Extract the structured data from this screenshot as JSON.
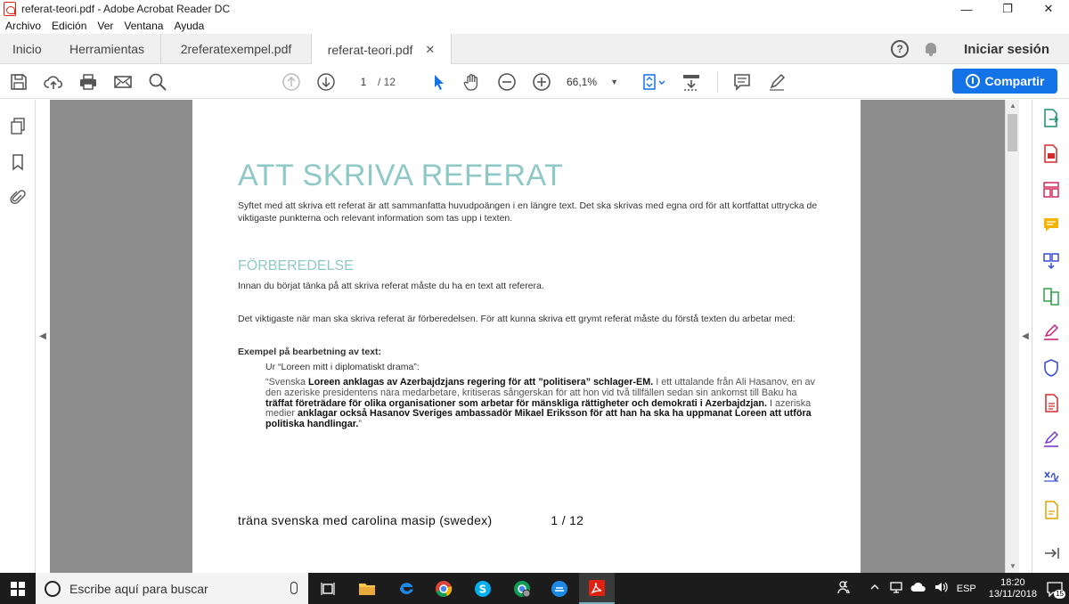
{
  "window": {
    "title": "referat-teori.pdf - Adobe Acrobat Reader DC",
    "minimize": "—",
    "maximize": "❐",
    "close": "✕"
  },
  "menu": [
    "Archivo",
    "Edición",
    "Ver",
    "Ventana",
    "Ayuda"
  ],
  "tabs": {
    "home": "Inicio",
    "tools": "Herramientas",
    "doc1": "2referatexempel.pdf",
    "doc2": "referat-teori.pdf",
    "close": "✕"
  },
  "header": {
    "help": "?",
    "signin": "Iniciar sesión"
  },
  "toolbar": {
    "page_current": "1",
    "page_total": "/ 12",
    "zoom": "66,1%",
    "zoom_caret": "▼",
    "share": "Compartir"
  },
  "document": {
    "title": "ATT SKRIVA REFERAT",
    "intro": "Syftet med att skriva ett referat är att sammanfatta huvudpoängen i en längre text. Det ska skrivas med egna ord för att kortfattat uttrycka de viktigaste punkterna och relevant information som tas upp i texten.",
    "section": "FÖRBEREDELSE",
    "p1": "Innan du börjat tänka på att skriva referat måste du ha en text att referera.",
    "p2": "Det viktigaste när man ska skriva referat är förberedelsen. För att kunna skriva ett grymt referat måste du förstå texten du arbetar med:",
    "example_heading": "Exempel på bearbetning av text:",
    "example_source": "Ur “Loreen mitt i diplomatiskt drama”:",
    "quote": {
      "s1": "“Svenska ",
      "b1": "Loreen anklagas av Azerbajdzjans regering för att ”politisera” schlager-EM.",
      "s2": " I ett uttalande från Ali Hasanov, en av den azeriske presidentens nära medarbetare, kritiseras sångerskan för att hon vid två tillfällen sedan sin ankomst till Baku ha ",
      "b2": "träffat företrädare för olika organisationer som arbetar för mänskliga rättigheter och demokrati i Azerbajdzjan.",
      "s3": " I azeriska medier ",
      "b3": "anklagar också Hasanov Sveriges ambassadör Mikael Eriksson för att han ha ska ha uppmanat Loreen att utföra politiska handlingar.",
      "s4": "”"
    },
    "footer_left": "träna svenska med carolina masip   (swedex)",
    "footer_page": "1 / 12"
  },
  "taskbar": {
    "search_placeholder": "Escribe aquí para buscar",
    "language": "ESP",
    "time": "18:20",
    "date": "13/11/2018",
    "notifications": "15"
  }
}
